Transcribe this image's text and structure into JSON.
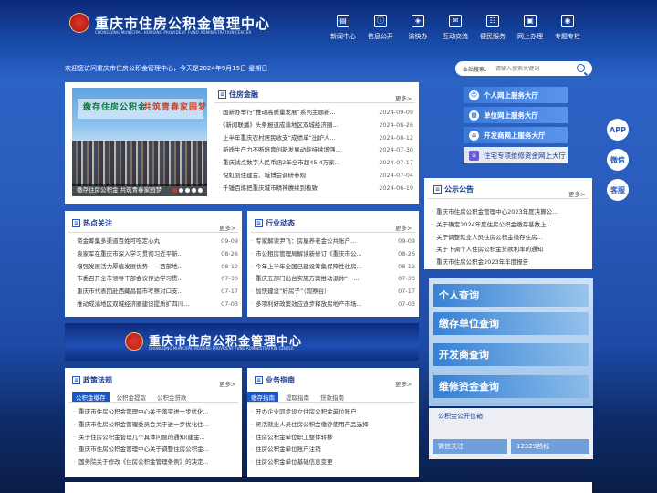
{
  "header": {
    "title": "重庆市住房公积金管理中心",
    "subtitle": "CHONGQING MUNICIPAL HOUSING PROVIDENT FUND ADMINISTRATION CENTER",
    "nav": [
      {
        "label": "新闻中心",
        "icon": "news-icon"
      },
      {
        "label": "信息公开",
        "icon": "info-icon"
      },
      {
        "label": "渝快办",
        "icon": "service-icon"
      },
      {
        "label": "互动交流",
        "icon": "chat-icon"
      },
      {
        "label": "便民服务",
        "icon": "convenience-icon"
      },
      {
        "label": "网上办理",
        "icon": "online-icon"
      },
      {
        "label": "专题专栏",
        "icon": "topic-icon"
      }
    ]
  },
  "welcome": "欢迎您访问重庆市住房公积金管理中心，今天是2024年9月15日 星期日",
  "search": {
    "label": "本站搜索：",
    "placeholder": "请输入搜索关键词"
  },
  "slideshow": {
    "banner_left": "缴存住房公积金",
    "banner_right": "共筑青春家园梦",
    "caption": "缴存住房公积金  共筑青春家园梦"
  },
  "housing_finance": {
    "title": "住房金融",
    "more": "更多>",
    "items": [
      {
        "t": "国新办举行“推动高质量发展”系列主题新...",
        "d": "2024-09-09"
      },
      {
        "t": "《新闻联播》头条报道成渝地区双城经济圈...",
        "d": "2024-08-26"
      },
      {
        "t": "上半年重庆农村居民收支“成绩单”出炉人...",
        "d": "2024-08-12"
      },
      {
        "t": "新质生产力不断培育创新发展动能持续增强...",
        "d": "2024-07-30"
      },
      {
        "t": "重庆试点数字人民币涵2年全市超45.4万家...",
        "d": "2024-07-17"
      },
      {
        "t": "倪虹到住建会、城博会调研参观",
        "d": "2024-07-04"
      },
      {
        "t": "千锤百炼把重庆城市精神赓续到极致",
        "d": "2024-06-19"
      }
    ]
  },
  "services": [
    {
      "label": "个人网上服务大厅",
      "icon": "person-icon"
    },
    {
      "label": "单位网上服务大厅",
      "icon": "building-icon"
    },
    {
      "label": "开发商网上服务大厅",
      "icon": "developer-icon"
    },
    {
      "label": "住宅专项维修资金网上大厅",
      "icon": "house-icon"
    }
  ],
  "floating": [
    {
      "label": "APP",
      "icon": "app-icon"
    },
    {
      "label": "微信",
      "icon": "wechat-icon"
    },
    {
      "label": "客服",
      "icon": "headset-icon"
    }
  ],
  "hot": {
    "title": "热点关注",
    "more": "更多>",
    "items": [
      {
        "t": "资金筹集多渠道百姓可吃定心丸",
        "d": "09-09"
      },
      {
        "t": "袁家军在重庆市深入学习贯彻习近平新...",
        "d": "08-26"
      },
      {
        "t": "增强发展活力厚植发展优势——西部地...",
        "d": "08-12"
      },
      {
        "t": "市委召开全市领导干部会议传达学习贯...",
        "d": "07-30"
      },
      {
        "t": "重庆市代表团赴西藏昌都市考察对口支...",
        "d": "07-17"
      },
      {
        "t": "推动成渝地区双城经济圈建设提质扩四川...",
        "d": "07-03"
      }
    ]
  },
  "industry": {
    "title": "行业动态",
    "more": "更多>",
    "items": [
      {
        "t": "专家解读尹飞：房屋养老金公共账户...",
        "d": "09-09"
      },
      {
        "t": "市公租房管理局解读新修订《重庆市公...",
        "d": "08-26"
      },
      {
        "t": "今年上半年全国已建设筹集保障性住房...",
        "d": "08-12"
      },
      {
        "t": "重庆五部门出台实施方案推动退休“一...",
        "d": "07-30"
      },
      {
        "t": "加快建设“好房子”（观察台）",
        "d": "07-17"
      },
      {
        "t": "多项利好政策效应逐步释放房地产市场...",
        "d": "07-03"
      }
    ]
  },
  "notice": {
    "title": "公示公告",
    "more": "更多>",
    "items": [
      {
        "t": "重庆市住房公积金管理中心2023年度决算公..."
      },
      {
        "t": "关于确定2024年度住房公积金缴存基数上..."
      },
      {
        "t": "关于调整就业人员住房公积金缴存住房..."
      },
      {
        "t": "关于下调个人住房公积金贷款利率的通知"
      },
      {
        "t": "重庆市住房公积金2023年年度报告"
      }
    ]
  },
  "queries": [
    "个人查询",
    "缴存单位查询",
    "开发商查询",
    "维修资金查询"
  ],
  "policy": {
    "title": "政策法规",
    "more": "更多>",
    "tabs": [
      "公积金缴存",
      "公积金提取",
      "公积金贷款"
    ],
    "items": [
      {
        "t": "重庆市住房公积金管理中心关于落实进一步优化..."
      },
      {
        "t": "重庆市住房公积金管理委员会关于进一步优化住..."
      },
      {
        "t": "关于住房公积金管理几个具体问题的通知(建金..."
      },
      {
        "t": "重庆市住房公积金管理中心关于调整住房公积金..."
      },
      {
        "t": "国务院关于修改《住房公积金管理条例》的决定..."
      }
    ]
  },
  "guide": {
    "title": "业务指南",
    "more": "更多>",
    "tabs": [
      "缴存指南",
      "提取指南",
      "贷款指南"
    ],
    "items": [
      {
        "t": "开办企业同步设立住房公积金单位账户"
      },
      {
        "t": "灵活就业人员住房公积金缴存使用产品选择"
      },
      {
        "t": "住房公积金单位职工整体转移"
      },
      {
        "t": "住房公积金单位账户注销"
      },
      {
        "t": "住房公积金单位基础信息变更"
      }
    ]
  },
  "weixin": {
    "title": "公积金公开信箱",
    "wechat": "微信关注",
    "hotline": "12329热线"
  }
}
